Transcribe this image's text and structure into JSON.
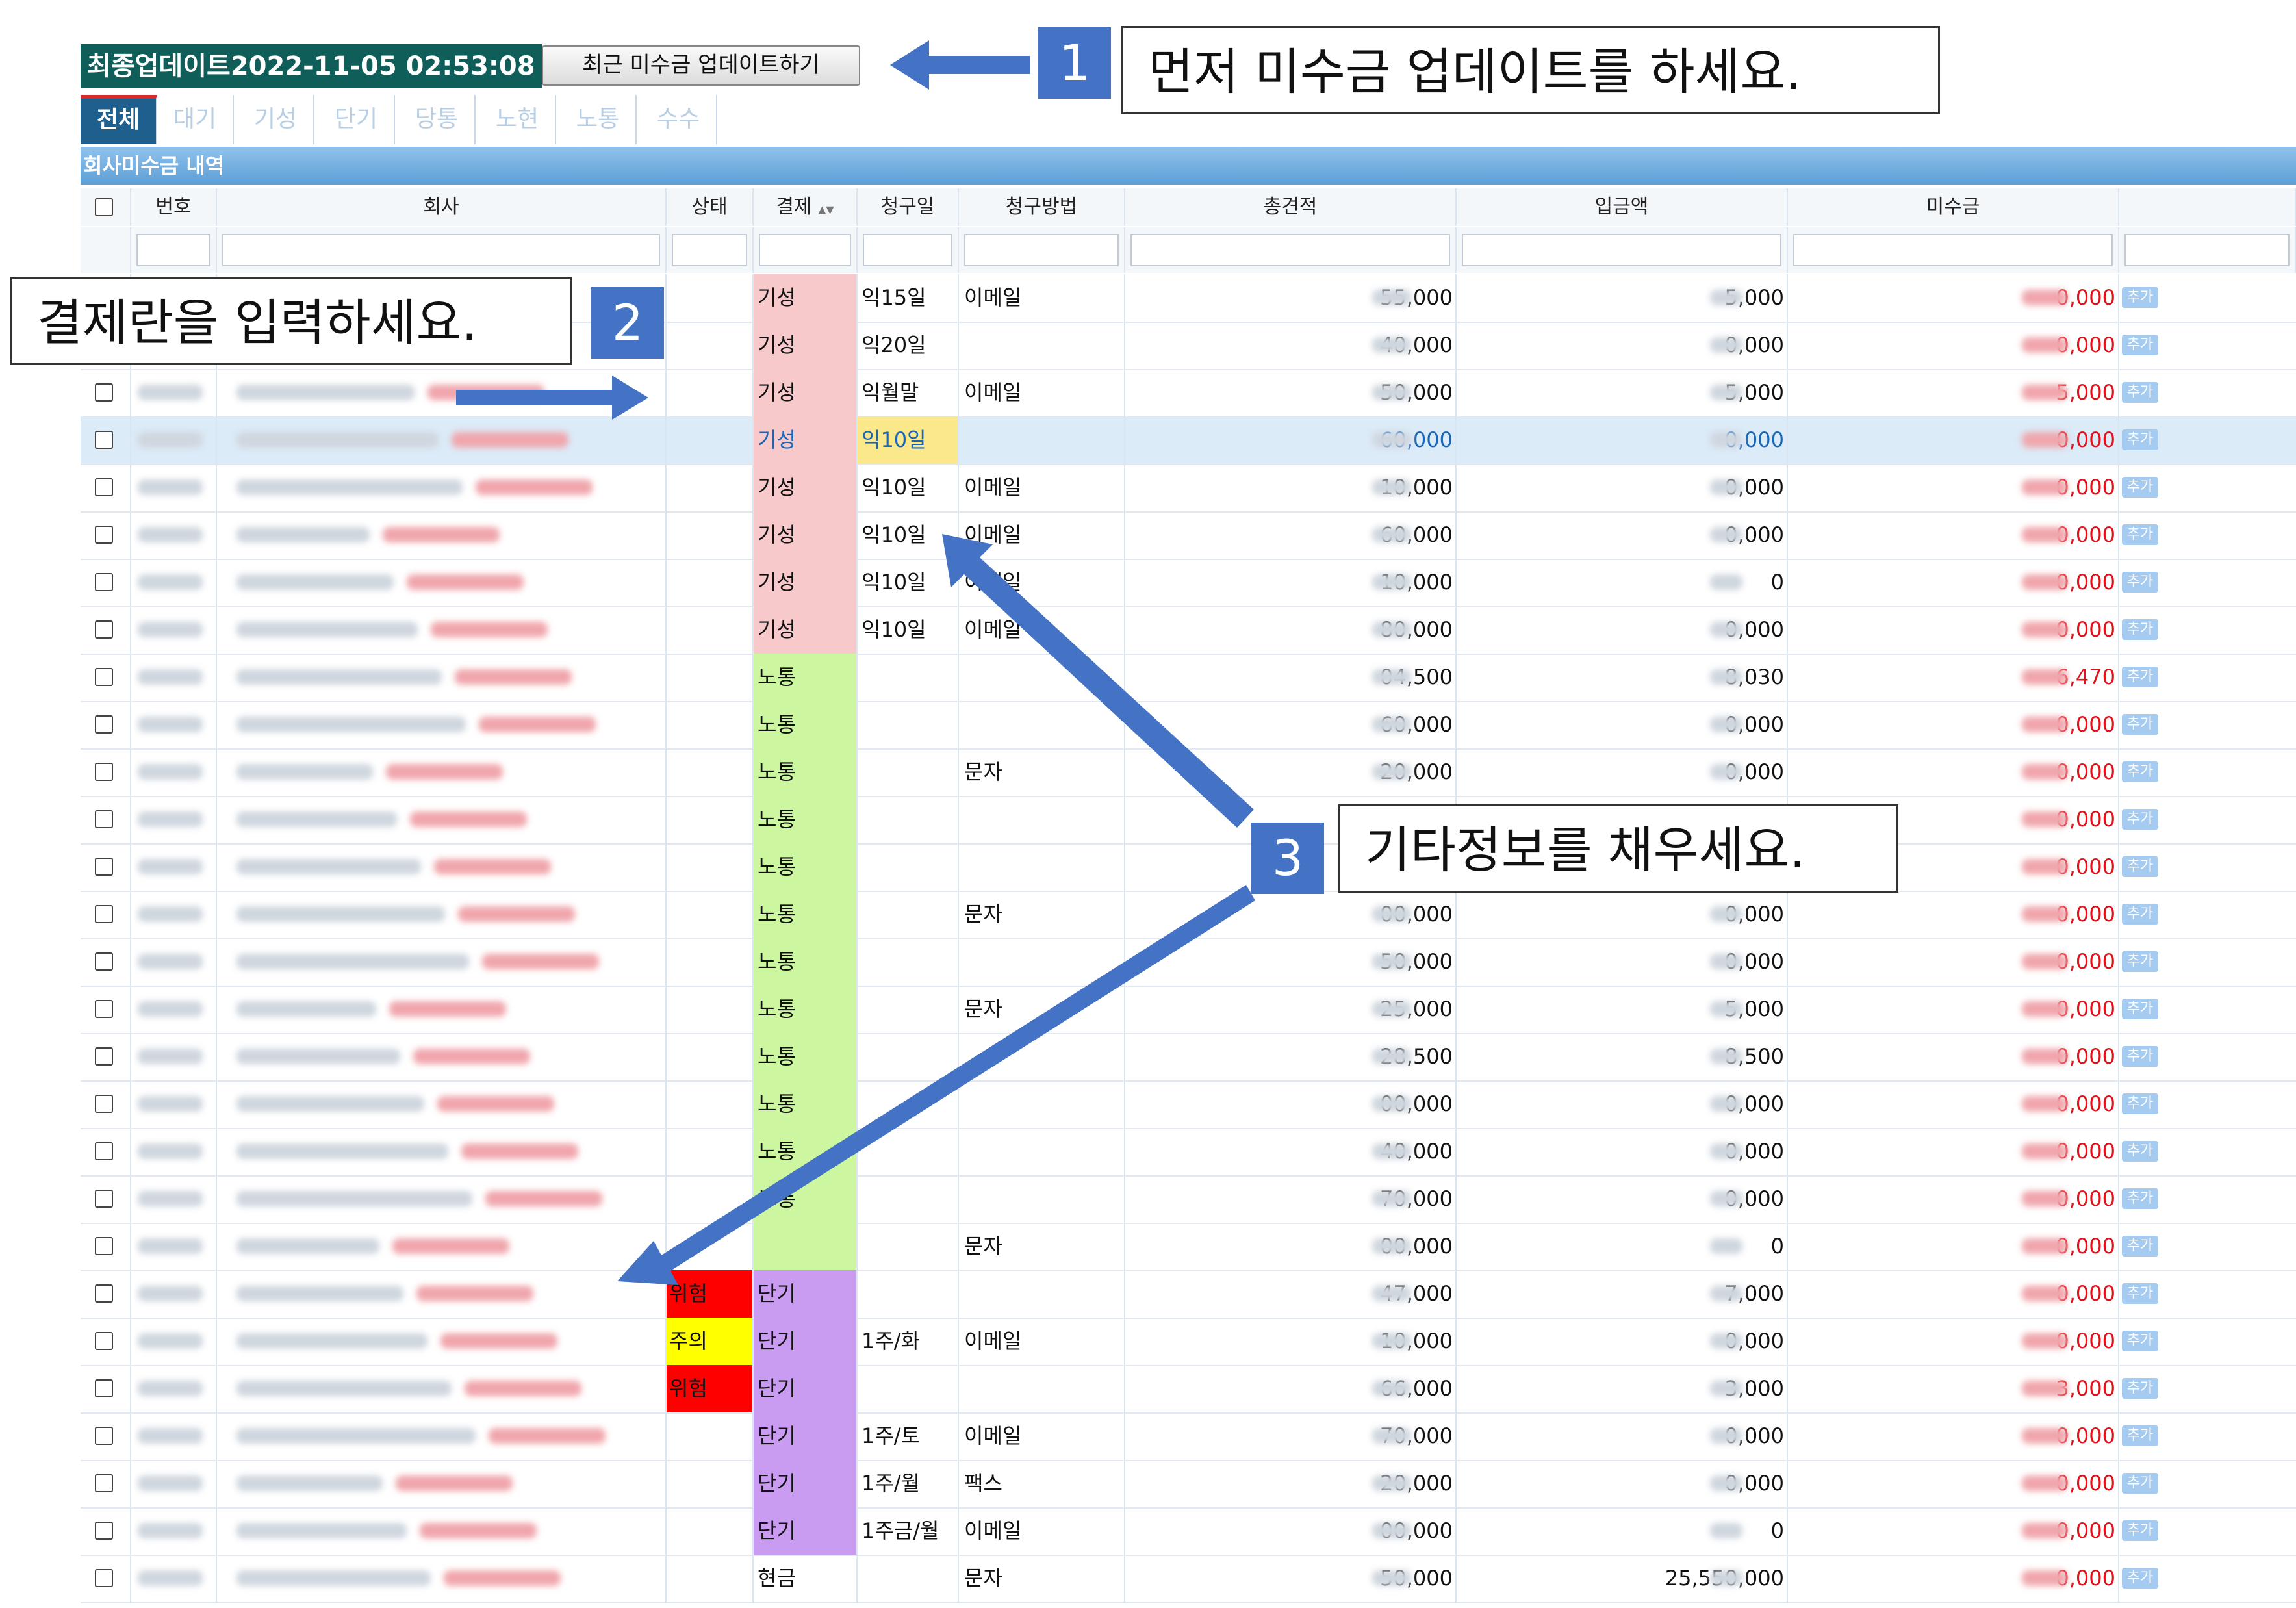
{
  "header": {
    "last_update": "최종업데이트2022-11-05 02:53:08",
    "update_button": "최근 미수금 업데이트하기"
  },
  "tabs": [
    "전체",
    "대기",
    "기성",
    "단기",
    "당통",
    "노현",
    "노통",
    "수수"
  ],
  "section_title": "회사미수금 내역",
  "columns": [
    "번호",
    "회사",
    "상태",
    "결제",
    "청구일",
    "청구방법",
    "총견적",
    "입금액",
    "미수금"
  ],
  "sort_indicator": "▲▼",
  "add_label": "추가",
  "rows": [
    {
      "status": "",
      "pay": "기성",
      "day": "익15일",
      "method": "이메일",
      "total": "55,000",
      "paid": "5,000",
      "due": "0,000"
    },
    {
      "status": "",
      "pay": "기성",
      "day": "익20일",
      "method": "",
      "total": "40,000",
      "paid": "0,000",
      "due": "0,000"
    },
    {
      "status": "",
      "pay": "기성",
      "day": "익월말",
      "method": "이메일",
      "total": "50,000",
      "paid": "5,000",
      "due": "5,000"
    },
    {
      "status": "",
      "pay": "기성",
      "day": "익10일",
      "method": "",
      "total": "60,000",
      "paid": "0,000",
      "due": "0,000"
    },
    {
      "status": "",
      "pay": "기성",
      "day": "익10일",
      "method": "이메일",
      "total": "10,000",
      "paid": "0,000",
      "due": "0,000"
    },
    {
      "status": "",
      "pay": "기성",
      "day": "익10일",
      "method": "이메일",
      "total": "60,000",
      "paid": "0,000",
      "due": "0,000"
    },
    {
      "status": "",
      "pay": "기성",
      "day": "익10일",
      "method": "이메일",
      "total": "10,000",
      "paid": "0",
      "due": "0,000"
    },
    {
      "status": "",
      "pay": "기성",
      "day": "익10일",
      "method": "이메일",
      "total": "80,000",
      "paid": "0,000",
      "due": "0,000"
    },
    {
      "status": "",
      "pay": "노통",
      "day": "",
      "method": "",
      "total": "04,500",
      "paid": "8,030",
      "due": "6,470"
    },
    {
      "status": "",
      "pay": "노통",
      "day": "",
      "method": "",
      "total": "60,000",
      "paid": "0,000",
      "due": "0,000"
    },
    {
      "status": "",
      "pay": "노통",
      "day": "",
      "method": "문자",
      "total": "20,000",
      "paid": "0,000",
      "due": "0,000"
    },
    {
      "status": "",
      "pay": "노통",
      "day": "",
      "method": "",
      "total": "60,",
      "paid": "",
      "due": "0,000"
    },
    {
      "status": "",
      "pay": "노통",
      "day": "",
      "method": "",
      "total": "0,",
      "paid": "",
      "due": "0,000"
    },
    {
      "status": "",
      "pay": "노통",
      "day": "",
      "method": "문자",
      "total": "00,000",
      "paid": "0,000",
      "due": "0,000"
    },
    {
      "status": "",
      "pay": "노통",
      "day": "",
      "method": "",
      "total": "50,000",
      "paid": "0,000",
      "due": "0,000"
    },
    {
      "status": "",
      "pay": "노통",
      "day": "",
      "method": "문자",
      "total": "25,000",
      "paid": "5,000",
      "due": "0,000"
    },
    {
      "status": "",
      "pay": "노통",
      "day": "",
      "method": "",
      "total": "28,500",
      "paid": "8,500",
      "due": "0,000"
    },
    {
      "status": "",
      "pay": "노통",
      "day": "",
      "method": "",
      "total": "00,000",
      "paid": "0,000",
      "due": "0,000"
    },
    {
      "status": "",
      "pay": "노통",
      "day": "",
      "method": "",
      "total": "40,000",
      "paid": "0,000",
      "due": "0,000"
    },
    {
      "status": "",
      "pay": "노통",
      "day": "",
      "method": "",
      "total": "70,000",
      "paid": "0,000",
      "due": "0,000"
    },
    {
      "status": "",
      "pay": "",
      "day": "",
      "method": "문자",
      "total": "00,000",
      "paid": "0",
      "due": "0,000"
    },
    {
      "status": "위험",
      "pay": "단기",
      "day": "",
      "method": "",
      "total": "47,000",
      "paid": "7,000",
      "due": "0,000"
    },
    {
      "status": "주의",
      "pay": "단기",
      "day": "1주/화",
      "method": "이메일",
      "total": "10,000",
      "paid": "0,000",
      "due": "0,000"
    },
    {
      "status": "위험",
      "pay": "단기",
      "day": "",
      "method": "",
      "total": "66,000",
      "paid": "3,000",
      "due": "3,000"
    },
    {
      "status": "",
      "pay": "단기",
      "day": "1주/토",
      "method": "이메일",
      "total": "70,000",
      "paid": "0,000",
      "due": "0,000"
    },
    {
      "status": "",
      "pay": "단기",
      "day": "1주/월",
      "method": "팩스",
      "total": "20,000",
      "paid": "0,000",
      "due": "0,000"
    },
    {
      "status": "",
      "pay": "단기",
      "day": "1주금/월",
      "method": "이메일",
      "total": "00,000",
      "paid": "0",
      "due": "0,000"
    },
    {
      "status": "",
      "pay": "현금",
      "day": "",
      "method": "문자",
      "total": "50,000",
      "paid": "25,550,000",
      "due": "0,000"
    }
  ],
  "annotations": [
    {
      "number": "1",
      "text": "먼저 미수금 업데이트를 하세요."
    },
    {
      "number": "2",
      "text": "결제란을 입력하세요."
    },
    {
      "number": "3",
      "text": "기타정보를 채우세요."
    }
  ],
  "colors": {
    "accent": "#4472c4",
    "header_bg": "#0f5e5a",
    "pay_gisung": "#f7c9cb",
    "pay_notong": "#ccf7a0",
    "pay_dangi": "#c99cf2",
    "status_danger": "#ff0000",
    "status_warning": "#ffff00",
    "due_text": "#e0121c"
  }
}
